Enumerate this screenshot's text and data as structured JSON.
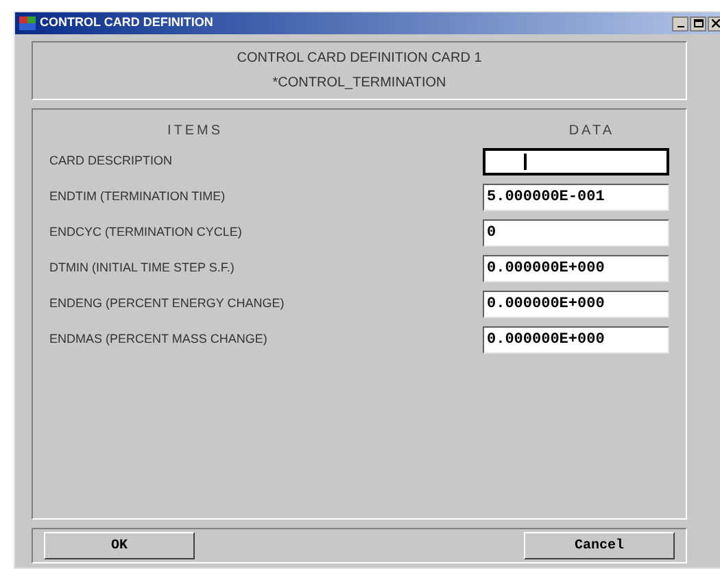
{
  "window": {
    "title": "CONTROL CARD DEFINITION"
  },
  "header": {
    "line_1": "CONTROL CARD DEFINITION CARD 1",
    "line_2": "*CONTROL_TERMINATION"
  },
  "table": {
    "columns": [
      "ITEMS",
      "DATA"
    ],
    "rows": [
      {
        "item": "CARD DESCRIPTION",
        "value": "",
        "focused": true
      },
      {
        "item": "ENDTIM (TERMINATION TIME)",
        "value": "5.000000E-001",
        "focused": false
      },
      {
        "item": "ENDCYC (TERMINATION CYCLE)",
        "value": "0",
        "focused": false
      },
      {
        "item": "DTMIN (INITIAL TIME STEP S.F.)",
        "value": "0.000000E+000",
        "focused": false
      },
      {
        "item": "ENDENG (PERCENT ENERGY CHANGE)",
        "value": "0.000000E+000",
        "focused": false
      },
      {
        "item": "ENDMAS (PERCENT MASS CHANGE)",
        "value": "0.000000E+000",
        "focused": false
      }
    ]
  },
  "buttons": [
    "OK",
    "Cancel"
  ]
}
